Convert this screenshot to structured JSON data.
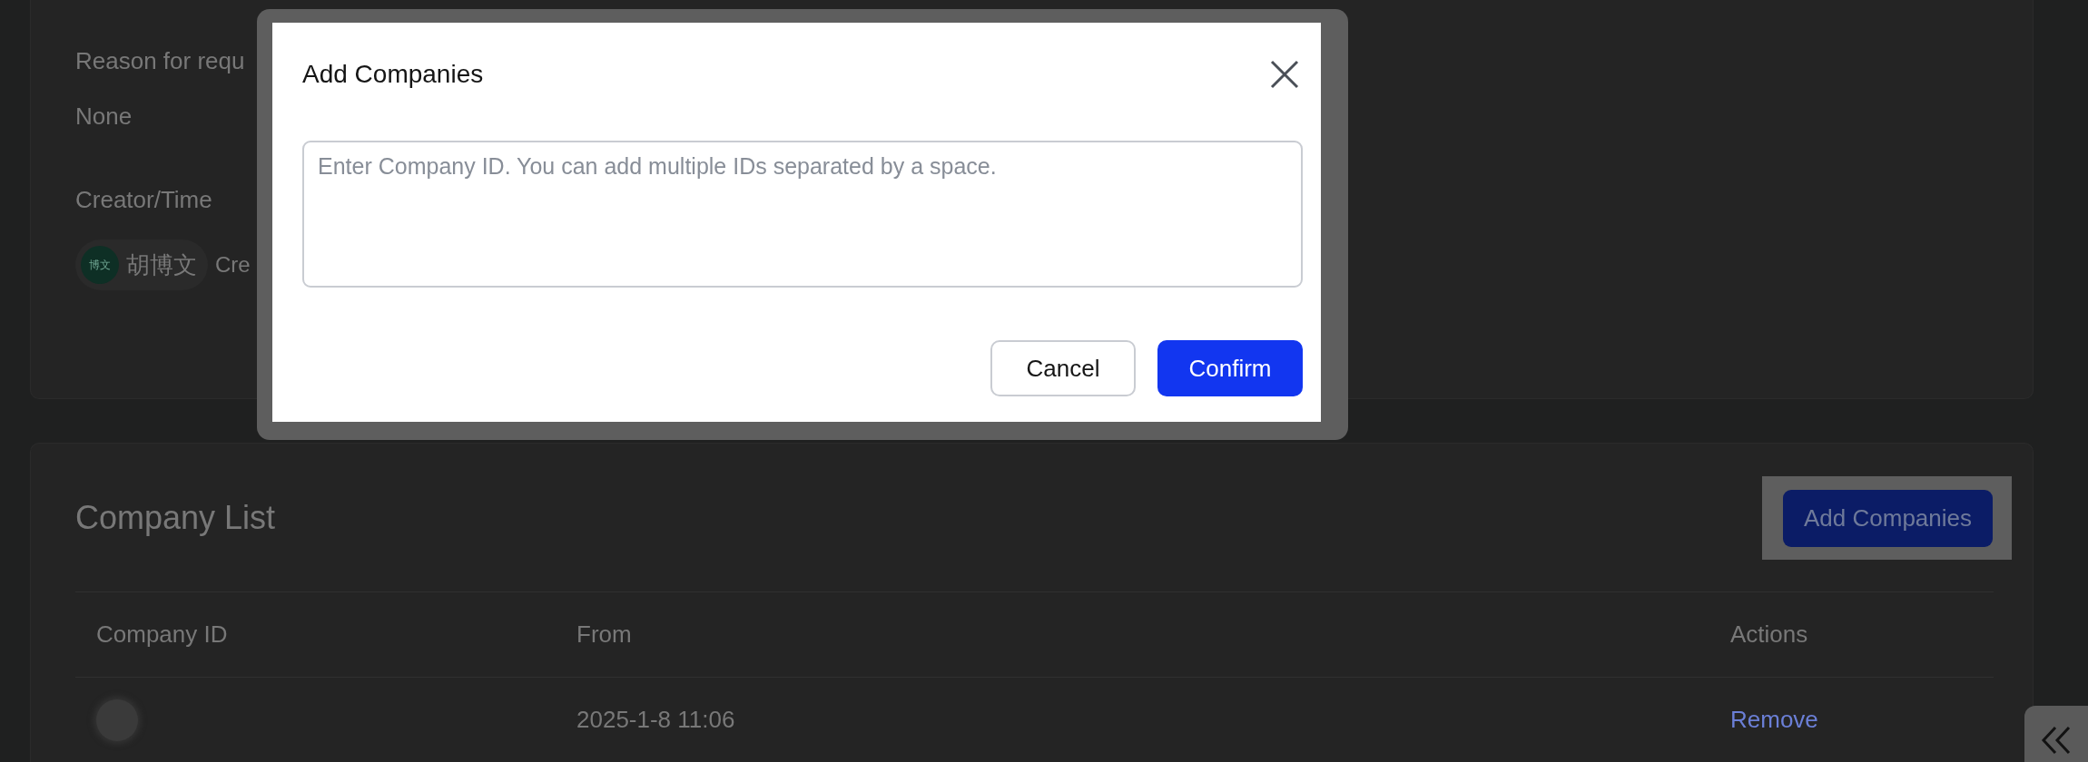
{
  "background_page": {
    "request_section": {
      "reason_label": "Reason for requ",
      "reason_value": "None",
      "creator_label": "Creator/Time",
      "creator": {
        "avatar_text": "博文",
        "name": "胡博文"
      },
      "created_text": "Cre"
    },
    "company_list": {
      "title": "Company List",
      "add_button": "Add Companies",
      "columns": [
        "Company ID",
        "From",
        "Actions"
      ],
      "rows": [
        {
          "from": "2025-1-8 11:06",
          "action": "Remove"
        }
      ]
    }
  },
  "dialog": {
    "title": "Add Companies",
    "input": {
      "placeholder": "Enter Company ID. You can add multiple IDs separated by a space."
    },
    "buttons": [
      {
        "label": "Cancel",
        "kind": "secondary"
      },
      {
        "label": "Confirm",
        "kind": "primary"
      }
    ]
  }
}
